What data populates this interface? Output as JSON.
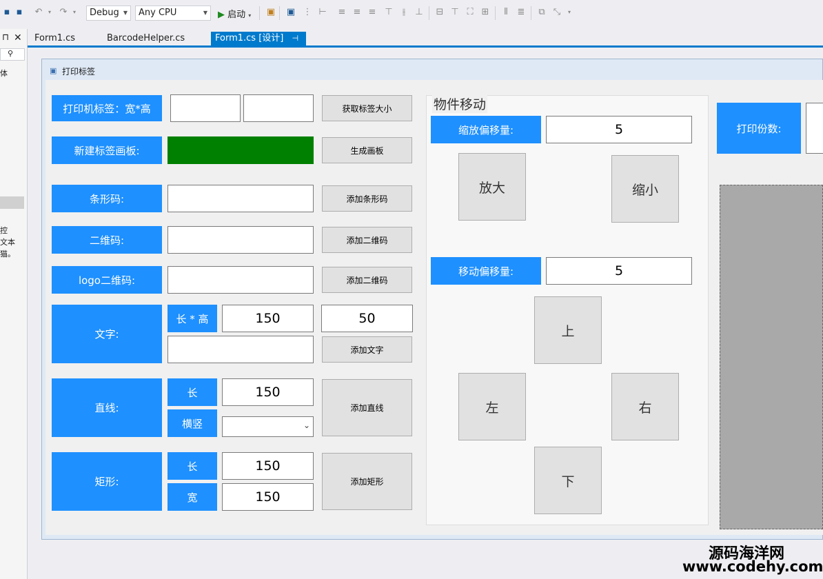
{
  "toolbar": {
    "config": "Debug",
    "platform": "Any CPU",
    "start_label": "启动"
  },
  "tabs": [
    {
      "label": "Form1.cs"
    },
    {
      "label": "BarcodeHelper.cs"
    },
    {
      "label": "Form1.cs [设计]"
    }
  ],
  "left_pane": {
    "text1": "体",
    "text2": "控",
    "text3": "文本",
    "text4": "猫。"
  },
  "form": {
    "title": "打印标签",
    "rows": {
      "label_size": {
        "label": "打印机标签：宽*高",
        "w": "",
        "h": "",
        "button": "获取标签大小"
      },
      "canvas": {
        "label": "新建标签画板:",
        "button": "生成画板"
      },
      "barcode": {
        "label": "条形码:",
        "value": "",
        "button": "添加条形码"
      },
      "qrcode": {
        "label": "二维码:",
        "value": "",
        "button": "添加二维码"
      },
      "logo_qr": {
        "label": "logo二维码:",
        "value": "",
        "button": "添加二维码"
      },
      "text": {
        "label": "文字:",
        "sub_label": "长 * 高",
        "w": "150",
        "h": "50",
        "value": "",
        "button": "添加文字"
      },
      "line": {
        "label": "直线:",
        "len_label": "长",
        "len": "150",
        "dir_label": "横竖",
        "dir": "",
        "button": "添加直线"
      },
      "rect": {
        "label": "矩形:",
        "len_label": "长",
        "len": "150",
        "wid_label": "宽",
        "wid": "150",
        "button": "添加矩形"
      }
    },
    "move_group": {
      "title": "物件移动",
      "scale_label": "缩放偏移量:",
      "scale_value": "5",
      "zoom_in": "放大",
      "zoom_out": "缩小",
      "move_label": "移动偏移量:",
      "move_value": "5",
      "up": "上",
      "left": "左",
      "right": "右",
      "down": "下"
    },
    "copies": {
      "label": "打印份数:",
      "value": ""
    }
  },
  "watermark": {
    "line1": "源码海洋网",
    "line2": "www.codehy.com"
  },
  "colors": {
    "accent": "#1e90ff",
    "canvas_green": "#008000",
    "tab_active": "#007acc"
  }
}
